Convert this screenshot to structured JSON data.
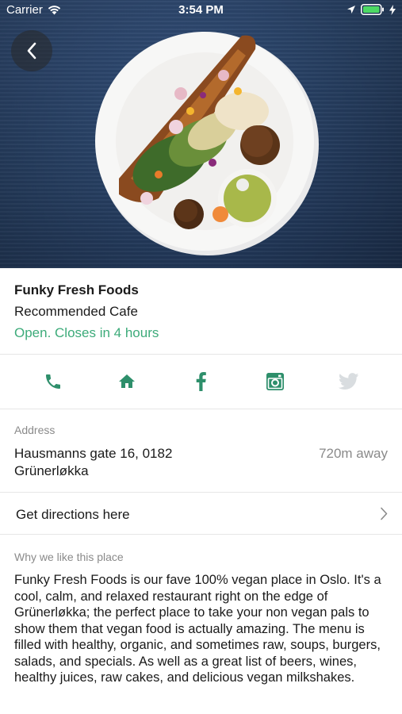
{
  "status_bar": {
    "carrier": "Carrier",
    "time": "3:54 PM"
  },
  "hero": {
    "image": "vegan-plate-photo"
  },
  "venue": {
    "name": "Funky Fresh Foods",
    "category": "Recommended Cafe",
    "hours": "Open. Closes in 4 hours",
    "open_color": "#3dab7a"
  },
  "actions": [
    {
      "icon": "phone-icon",
      "enabled": true
    },
    {
      "icon": "home-icon",
      "enabled": true
    },
    {
      "icon": "facebook-icon",
      "enabled": true
    },
    {
      "icon": "instagram-icon",
      "enabled": true
    },
    {
      "icon": "twitter-icon",
      "enabled": false
    }
  ],
  "address": {
    "label": "Address",
    "line1": "Hausmanns gate 16, 0182",
    "line2": "Grünerløkka",
    "distance": "720m away"
  },
  "directions": {
    "label": "Get directions here"
  },
  "why": {
    "label": "Why we like this place",
    "text": "Funky Fresh Foods is our fave 100% vegan place in Oslo. It's a cool, calm, and relaxed restaurant right on the edge of Grünerløkka; the perfect place to take your non vegan pals to show them that vegan food is actually amazing. The menu is filled with healthy, organic, and sometimes raw, soups, burgers, salads, and specials. As well as a great list of beers, wines, healthy juices, raw cakes, and delicious vegan milkshakes."
  },
  "colors": {
    "accent": "#2e8f6b",
    "disabled": "#d9dde0"
  }
}
